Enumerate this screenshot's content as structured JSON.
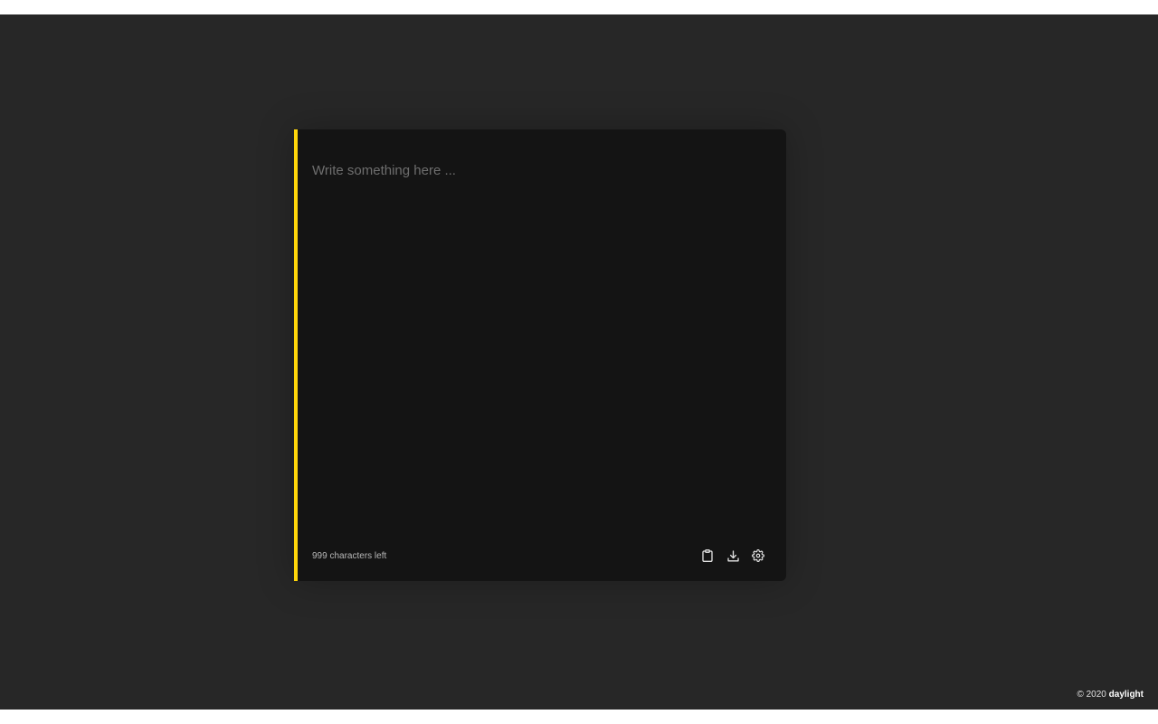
{
  "editor": {
    "placeholder": "Write something here ...",
    "value": "",
    "accent_color": "#ffd60a",
    "characters_left_text": "999 characters left"
  },
  "toolbar": {
    "buttons": [
      {
        "name": "copy",
        "icon": "clipboard-icon"
      },
      {
        "name": "download",
        "icon": "download-icon"
      },
      {
        "name": "settings",
        "icon": "gear-icon"
      }
    ]
  },
  "footer": {
    "copyright": "© 2020",
    "brand": "daylight"
  }
}
